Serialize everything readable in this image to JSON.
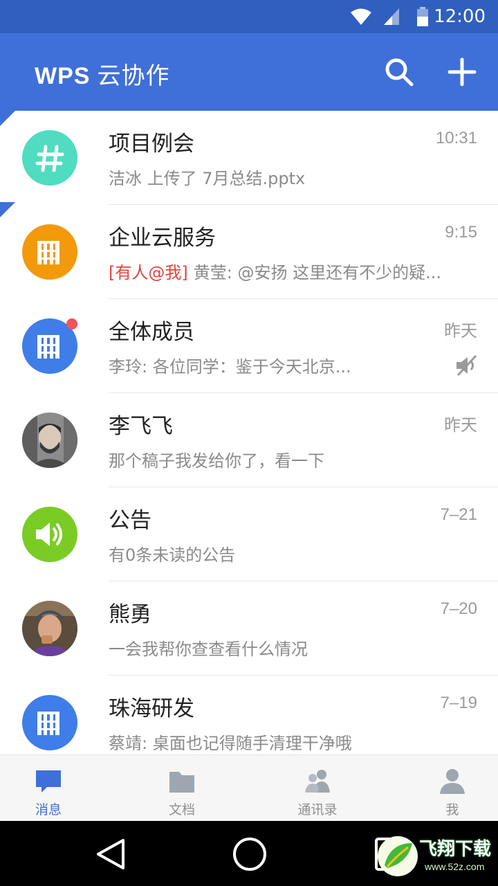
{
  "status_bar": {
    "time": "12:00"
  },
  "app_bar": {
    "title_brand": "WPS",
    "title_suffix": "云协作",
    "search_icon": "search-icon",
    "add_icon": "plus-icon"
  },
  "colors": {
    "primary": "#3f6fd8",
    "status": "#2f5fbf",
    "mention": "#e0453e",
    "unread_dot": "#f0545a"
  },
  "conversations": [
    {
      "name": "项目例会",
      "time": "10:31",
      "preview": "洁冰 上传了 7月总结.pptx",
      "avatar": "hash-icon",
      "avatar_color": "#4fdcc0"
    },
    {
      "name": "企业云服务",
      "time": "9:15",
      "mention": "[有人@我]",
      "preview": "黄莹: @安扬 这里还有不少的疑...",
      "avatar": "building-icon",
      "avatar_color": "#f29a0c"
    },
    {
      "name": "全体成员",
      "time": "昨天",
      "preview": "李玲: 各位同学：鉴于今天北京...",
      "avatar": "building-icon",
      "avatar_color": "#3f7de8"
    },
    {
      "name": "李飞飞",
      "time": "昨天",
      "preview": "那个稿子我发给你了，看一下",
      "avatar": "user-photo"
    },
    {
      "name": "公告",
      "time": "7–21",
      "preview": "有0条未读的公告",
      "avatar": "speaker-icon",
      "avatar_color": "#7acc25"
    },
    {
      "name": "熊勇",
      "time": "7–20",
      "preview": "一会我帮你查查看什么情况",
      "avatar": "user-photo"
    },
    {
      "name": "珠海研发",
      "time": "7–19",
      "preview": "蔡靖: 桌面也记得随手清理干净哦",
      "avatar": "building-icon",
      "avatar_color": "#3f7de8"
    }
  ],
  "tabs": [
    {
      "label": "消息",
      "icon": "chat-icon",
      "active": true
    },
    {
      "label": "文档",
      "icon": "folder-icon",
      "active": false
    },
    {
      "label": "通讯录",
      "icon": "contacts-icon",
      "active": false
    },
    {
      "label": "我",
      "icon": "person-icon",
      "active": false
    }
  ],
  "watermark": {
    "text": "飞翔下载",
    "url": "www.52z.com"
  }
}
